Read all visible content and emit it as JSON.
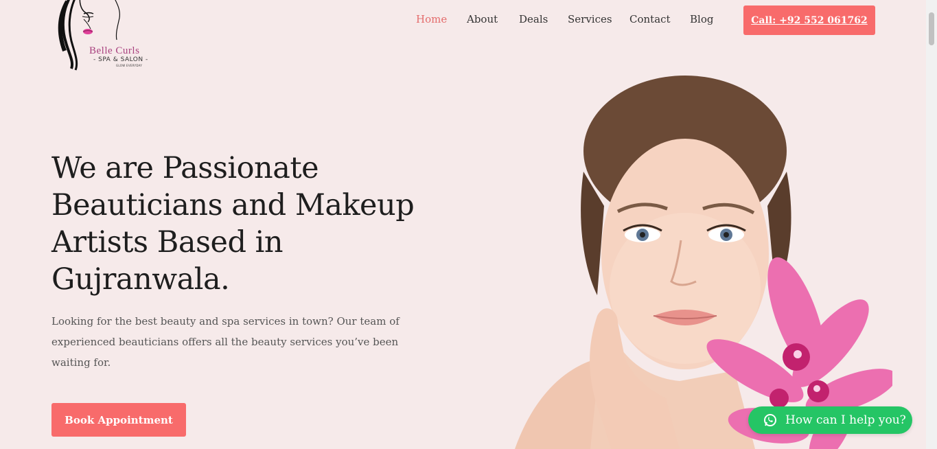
{
  "brand": {
    "name": "Belle Curls",
    "subtitle": "- SPA & SALON -",
    "tagline": "GLOW EVERYDAY"
  },
  "nav": {
    "items": [
      {
        "label": "Home",
        "active": true
      },
      {
        "label": "About",
        "active": false
      },
      {
        "label": "Deals",
        "active": false
      },
      {
        "label": "Services",
        "active": false
      },
      {
        "label": "Contact",
        "active": false
      },
      {
        "label": "Blog",
        "active": false
      }
    ],
    "call_label": "Call: +92 552 061762"
  },
  "hero": {
    "title": "We are Passionate Beauticians and Makeup Artists Based in Gujranwala.",
    "text": "Looking for the best beauty and spa services in town? Our team of experienced beauticians offers all the beauty services you’ve been waiting for.",
    "book_label": "Book Appointment"
  },
  "whatsapp": {
    "label": "How can I help you?"
  },
  "colors": {
    "background": "#f6eaea",
    "accent": "#f86b6b",
    "active_nav": "#e46c6c",
    "whatsapp": "#25c565",
    "brand_text": "#a8407e"
  },
  "icons": {
    "whatsapp": "whatsapp-icon",
    "logo": "woman-silhouette-logo"
  }
}
